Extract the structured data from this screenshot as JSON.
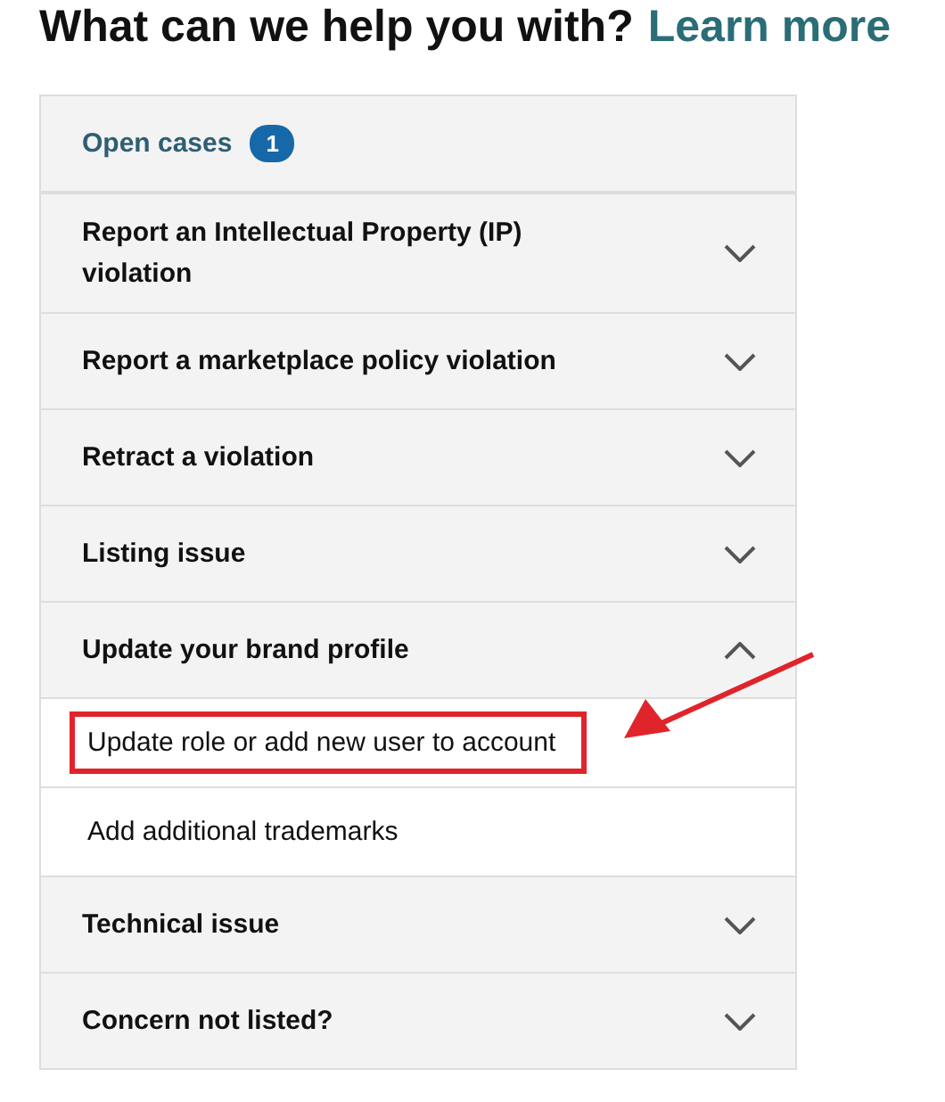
{
  "heading": {
    "title": "What can we help you with?",
    "link": "Learn more"
  },
  "open_cases": {
    "label": "Open cases",
    "count": "1"
  },
  "sections": [
    {
      "label": "Report an Intellectual Property (IP) violation",
      "expanded": false
    },
    {
      "label": "Report a marketplace policy violation",
      "expanded": false
    },
    {
      "label": "Retract a violation",
      "expanded": false
    },
    {
      "label": "Listing issue",
      "expanded": false
    },
    {
      "label": "Update your brand profile",
      "expanded": true,
      "children": [
        {
          "label": "Update role or add new user to account",
          "highlighted": true
        },
        {
          "label": "Add additional trademarks",
          "highlighted": false
        }
      ]
    },
    {
      "label": "Technical issue",
      "expanded": false
    },
    {
      "label": "Concern not listed?",
      "expanded": false
    }
  ]
}
